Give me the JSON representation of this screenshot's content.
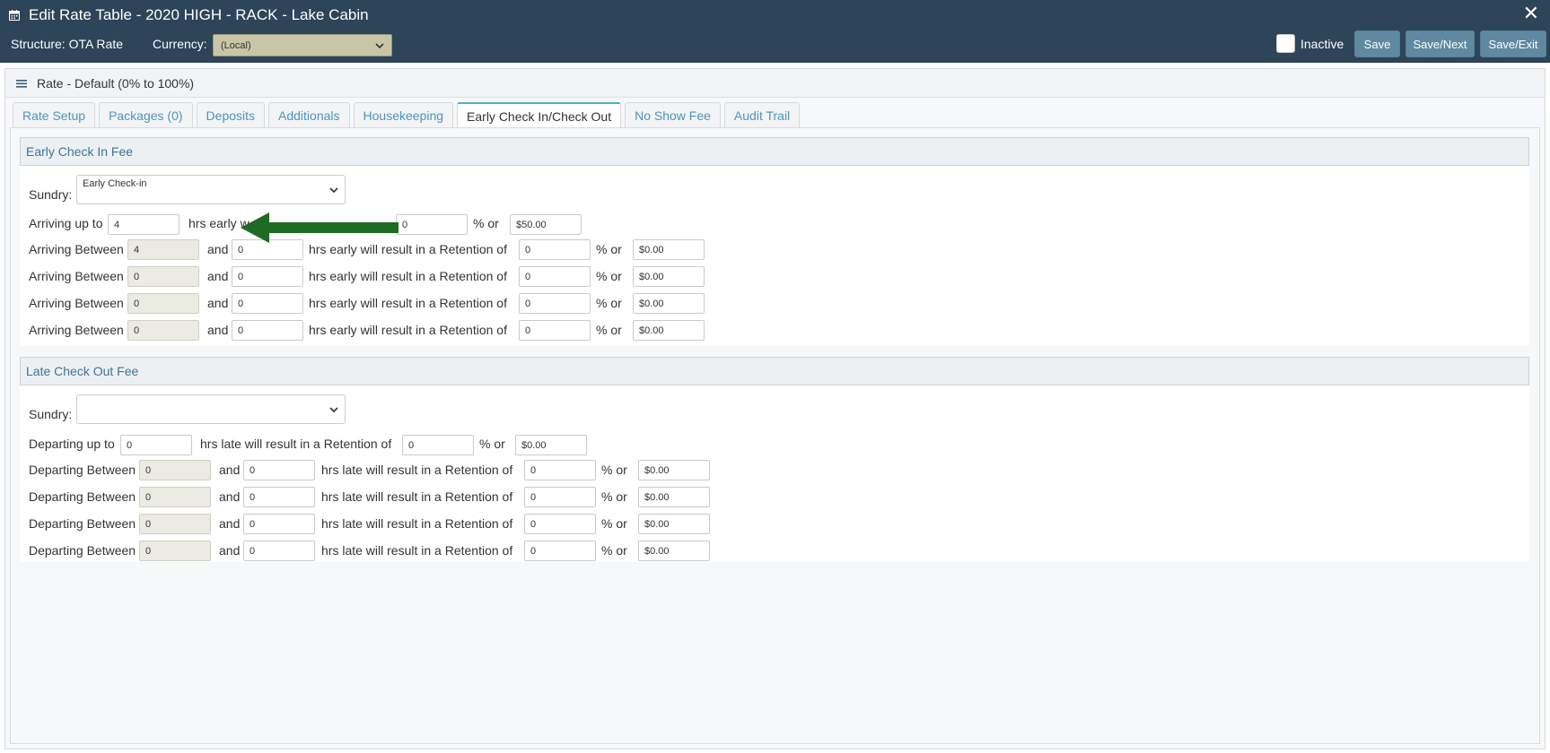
{
  "header": {
    "title": "Edit Rate Table - 2020 HIGH - RACK - Lake Cabin",
    "close_label": "✕",
    "structure_label": "Structure: OTA Rate",
    "currency_label": "Currency:",
    "currency_value": "(Local)",
    "inactive_label": "Inactive",
    "inactive_checked": false,
    "save_label": "Save",
    "save_next_label": "Save/Next",
    "save_exit_label": "Save/Exit"
  },
  "rate": {
    "title": "Rate - Default (0% to 100%)"
  },
  "tabs": [
    {
      "label": "Rate Setup"
    },
    {
      "label": "Packages (0)"
    },
    {
      "label": "Deposits"
    },
    {
      "label": "Additionals"
    },
    {
      "label": "Housekeeping"
    },
    {
      "label": "Early Check In/Check Out",
      "active": true
    },
    {
      "label": "No Show Fee"
    },
    {
      "label": "Audit Trail"
    }
  ],
  "early": {
    "heading": "Early Check In Fee",
    "sundry_label": "Sundry:",
    "sundry_value": "Early Check-in",
    "first_row": {
      "prefix": "Arriving up to",
      "hours": "4",
      "suffix_visible": "hrs early w",
      "retention_pct": "0",
      "pct_or": "% or",
      "amount": "$50.00"
    },
    "rows": [
      {
        "label": "Arriving Between",
        "from": "4",
        "and": "and",
        "to": "0",
        "text": "hrs early will result in a Retention of",
        "pct": "0",
        "pct_or": "% or",
        "amount": "$0.00"
      },
      {
        "label": "Arriving Between",
        "from": "0",
        "and": "and",
        "to": "0",
        "text": "hrs early will result in a Retention of",
        "pct": "0",
        "pct_or": "% or",
        "amount": "$0.00"
      },
      {
        "label": "Arriving Between",
        "from": "0",
        "and": "and",
        "to": "0",
        "text": "hrs early will result in a Retention of",
        "pct": "0",
        "pct_or": "% or",
        "amount": "$0.00"
      },
      {
        "label": "Arriving Between",
        "from": "0",
        "and": "and",
        "to": "0",
        "text": "hrs early will result in a Retention of",
        "pct": "0",
        "pct_or": "% or",
        "amount": "$0.00"
      }
    ]
  },
  "late": {
    "heading": "Late Check Out Fee",
    "sundry_label": "Sundry:",
    "sundry_value": "",
    "first_row": {
      "prefix": "Departing up to",
      "hours": "0",
      "text": "hrs late will result in a Retention of",
      "retention_pct": "0",
      "pct_or": "% or",
      "amount": "$0.00"
    },
    "rows": [
      {
        "label": "Departing Between",
        "from": "0",
        "and": "and",
        "to": "0",
        "text": "hrs late will result in a Retention of",
        "pct": "0",
        "pct_or": "% or",
        "amount": "$0.00"
      },
      {
        "label": "Departing Between",
        "from": "0",
        "and": "and",
        "to": "0",
        "text": "hrs late will result in a Retention of",
        "pct": "0",
        "pct_or": "% or",
        "amount": "$0.00"
      },
      {
        "label": "Departing Between",
        "from": "0",
        "and": "and",
        "to": "0",
        "text": "hrs late will result in a Retention of",
        "pct": "0",
        "pct_or": "% or",
        "amount": "$0.00"
      },
      {
        "label": "Departing Between",
        "from": "0",
        "and": "and",
        "to": "0",
        "text": "hrs late will result in a Retention of",
        "pct": "0",
        "pct_or": "% or",
        "amount": "$0.00"
      }
    ]
  },
  "colors": {
    "header_bg": "#2d4459",
    "button_bg": "#5f89a1",
    "tab_link": "#4c93be",
    "section_heading": "#3f7397",
    "annotation_arrow": "#1e6b24"
  },
  "icons": {
    "title": "calendar-icon",
    "close": "close-icon",
    "menu": "hamburger-icon",
    "select": "chevron-down-icon",
    "annotation": "arrow-left-icon"
  }
}
